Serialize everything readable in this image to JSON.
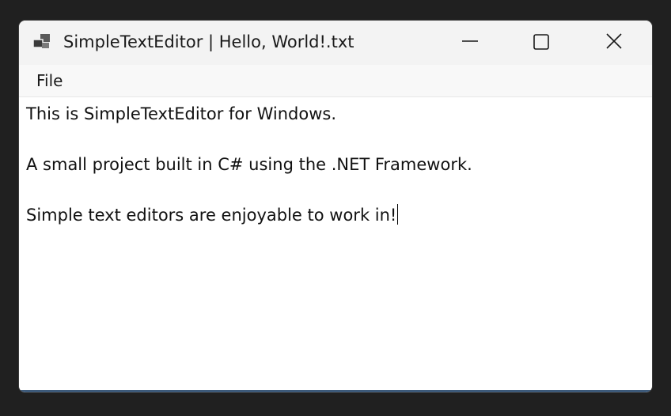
{
  "window": {
    "title": "SimpleTextEditor | Hello, World!.txt",
    "app_icon": "window-stack-icon",
    "controls": {
      "minimize_icon": "minimize-icon",
      "maximize_icon": "maximize-icon",
      "close_icon": "close-icon"
    }
  },
  "menu": {
    "items": [
      {
        "label": "File"
      }
    ]
  },
  "editor": {
    "lines": [
      "This is SimpleTextEditor for Windows.",
      "",
      "A small project built in C# using the .NET Framework.",
      "",
      "Simple text editors are enjoyable to work in!"
    ]
  },
  "colors": {
    "desktop": "#202020",
    "titlebar": "#f3f3f3",
    "menubar": "#f8f8f8",
    "editor_background": "#ffffff",
    "text": "#111111",
    "bottom_accent": "#3d5a7a"
  }
}
